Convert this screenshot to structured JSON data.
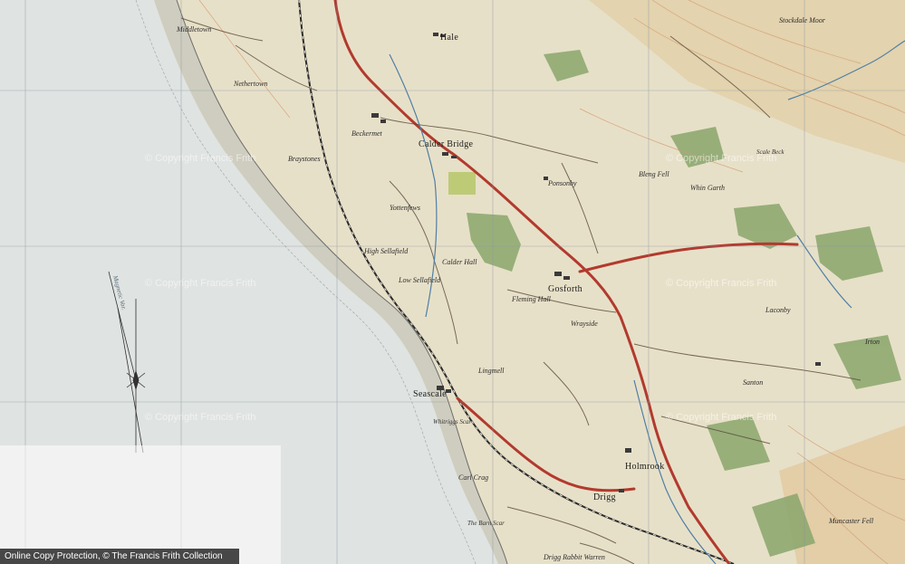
{
  "map": {
    "places": {
      "hale": "Hale",
      "calder_bridge": "Calder Bridge",
      "gosforth": "Gosforth",
      "seascale": "Seascale",
      "holmrook": "Holmrook",
      "drigg": "Drigg",
      "ponsonby": "Ponsonby",
      "calder_hall": "Calder Hall",
      "high_sellafield": "High Sellafield",
      "low_sellafield": "Low Sellafield",
      "yottenfews": "Yottenfews",
      "beckermet": "Beckermet",
      "laconby": "Laconby",
      "santon": "Santon",
      "irton": "Irton",
      "muncaster_fell": "Muncaster Fell",
      "fleming_hall": "Fleming Hall",
      "wrayside": "Wrayside",
      "bleng_fell": "Bleng Fell",
      "whin_garth": "Whin Garth",
      "stockdale_moor": "Stockdale Moor",
      "lingmell": "Lingmell",
      "carl_crag": "Carl Crag",
      "drigg_rabbit_warren": "Drigg Rabbit Warren",
      "nethertown": "Nethertown",
      "middletown": "Middletown",
      "braystones": "Braystones",
      "scale_beck": "Scale Beck",
      "whitriggs_scar": "Whitriggs Scar",
      "the_barn_scar": "The Barn Scar"
    },
    "compass_text": "Magnetic Var.",
    "watermark": "© Copyright Francis Frith"
  },
  "footer": {
    "copyright": "Online Copy Protection, © The Francis Frith Collection"
  },
  "colors": {
    "sea": "#dfe3e1",
    "land": "#e7e0c8",
    "road_main": "#b23a2e",
    "woodland": "#7f9a62",
    "contour": "#d9a07a",
    "grid": "#8a97a3"
  }
}
